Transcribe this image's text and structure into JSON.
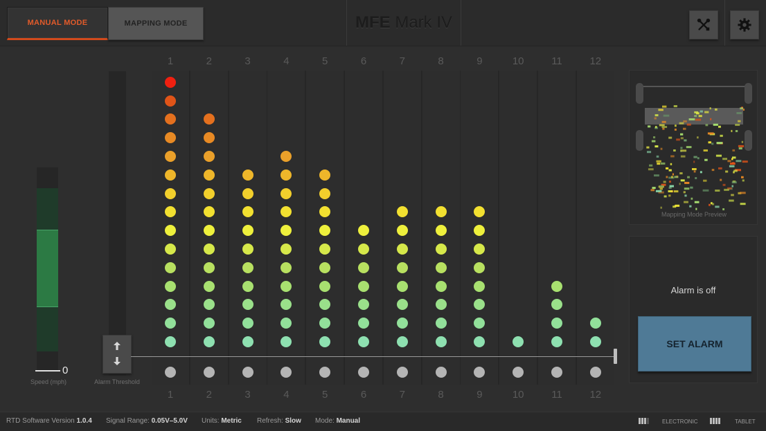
{
  "header": {
    "manual_mode_label": "MANUAL MODE",
    "mapping_mode_label": "MAPPING MODE",
    "title_bold": "MFE",
    "title_rest": " Mark IV",
    "tools_icon": "wrench-screwdriver-icon",
    "settings_icon": "gear-icon"
  },
  "columns": [
    "1",
    "2",
    "3",
    "4",
    "5",
    "6",
    "7",
    "8",
    "9",
    "10",
    "11",
    "12"
  ],
  "column_levels": [
    15,
    13,
    10,
    11,
    10,
    7,
    8,
    8,
    8,
    1,
    4,
    2
  ],
  "level_colors": [
    "#8ee0b0",
    "#92e09a",
    "#9ae08a",
    "#a8e070",
    "#b8e060",
    "#d6e84a",
    "#eef03c",
    "#f2e030",
    "#f2cf2c",
    "#eeb62a",
    "#eaa02a",
    "#e88a24",
    "#e4701e",
    "#e05418",
    "#f02010"
  ],
  "baseline_dot_color": "#b4b4b4",
  "speed": {
    "value": "0",
    "label": "Speed (mph)"
  },
  "threshold": {
    "label": "Alarm Threshold",
    "up_icon": "arrow-up-icon",
    "down_icon": "arrow-down-icon"
  },
  "preview": {
    "label": "Mapping Mode Preview"
  },
  "alarm": {
    "status": "Alarm is off",
    "button_label": "SET ALARM"
  },
  "footer": {
    "version_label": "RTD Software Version",
    "version_value": "1.0.4",
    "signal_label": "Signal Range:",
    "signal_value": "0.05V–5.0V",
    "units_label": "Units:",
    "units_value": "Metric",
    "refresh_label": "Refresh:",
    "refresh_value": "Slow",
    "mode_label": "Mode:",
    "mode_value": "Manual",
    "electronic_label": "ELECTRONIC",
    "tablet_label": "TABLET",
    "electronic_battery_level": 0.75,
    "tablet_battery_level": 1.0
  }
}
